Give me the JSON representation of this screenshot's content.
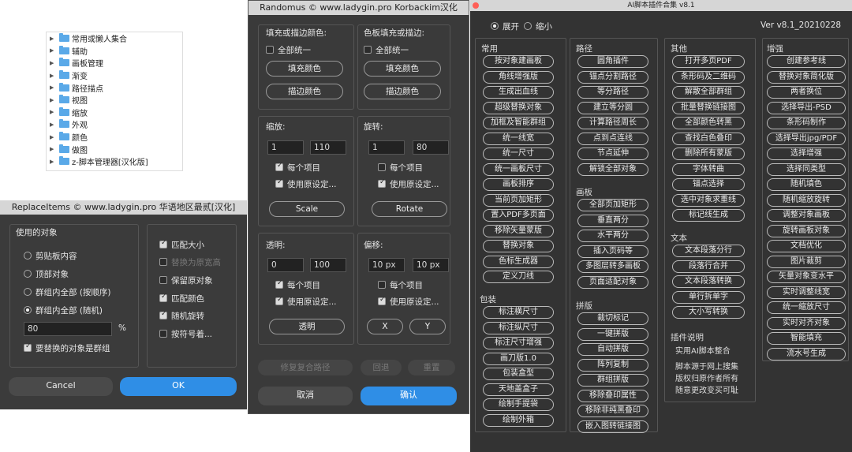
{
  "tree": {
    "items": [
      "常用或懒人集合",
      "辅助",
      "画板管理",
      "渐变",
      "路径描点",
      "视图",
      "缩放",
      "外观",
      "颜色",
      "做图",
      "z-脚本管理器[汉化版]"
    ]
  },
  "replace_items": {
    "title": "ReplaceItems © www.ladygin.pro 华语地区最贰[汉化]",
    "group_label": "使用的对象",
    "radios": [
      "剪贴板内容",
      "顶部对象",
      "群组内全部 (按顺序)",
      "群组内全部 (随机)"
    ],
    "percent_value": "80",
    "percent_sign": "%",
    "group_checkbox": "要替换的对象是群组",
    "checks": [
      "匹配大小",
      "替换为原宽高",
      "保留原对象",
      "匹配颜色",
      "随机旋转",
      "按符号着..."
    ],
    "cancel": "Cancel",
    "ok": "OK"
  },
  "randomus": {
    "title": "Randomus © www.ladygin.pro  Korbackim汉化",
    "fill_stroke": {
      "label": "填充或描边颜色:",
      "check": "全部统一",
      "fill": "填充颜色",
      "stroke": "描边颜色"
    },
    "swatch": {
      "label": "色板填充或描边:",
      "check": "全部统一",
      "fill": "填充颜色",
      "stroke": "描边颜色"
    },
    "scale": {
      "label": "缩放:",
      "min": "1",
      "max": "110",
      "each": "每个项目",
      "orig": "使用原设定...",
      "btn": "Scale"
    },
    "rotate": {
      "label": "旋转:",
      "min": "1",
      "max": "80",
      "each": "每个项目",
      "orig": "使用原设定...",
      "btn": "Rotate"
    },
    "opacity": {
      "label": "透明:",
      "min": "0",
      "max": "100",
      "each": "每个项目",
      "orig": "使用原设定...",
      "btn": "透明"
    },
    "offset": {
      "label": "偏移:",
      "min": "10 px",
      "max": "10 px",
      "each": "每个项目",
      "orig": "使用原设定...",
      "btnx": "X",
      "btny": "Y"
    },
    "restore": "修复复合路径",
    "back": "回退",
    "reset": "重置",
    "cancel": "取消",
    "confirm": "确认"
  },
  "ai": {
    "title": "AI脚本插件合集 v8.1",
    "expand": "展开",
    "shrink": "缩小",
    "version": "Ver v8.1_20210228",
    "common": {
      "head": "常用",
      "items": [
        "按对象建画板",
        "角线增强版",
        "生成出血线",
        "超级替换对象",
        "加框及智能群组",
        "统一线宽",
        "统一尺寸",
        "统一画板尺寸",
        "画板排序",
        "当前页加矩形",
        "置入PDF多页面",
        "移除矢量蒙版",
        "替换对象",
        "色标生成器",
        "定义刀线"
      ]
    },
    "package": {
      "head": "包装",
      "items": [
        "标注横尺寸",
        "标注纵尺寸",
        "标注尺寸增强",
        "画刀版1.0",
        "包装盒型",
        "天地盖盒子",
        "绘制手提袋",
        "绘制外箱"
      ]
    },
    "path": {
      "head": "路径",
      "items": [
        "圆角插件",
        "锚点分割路径",
        "等分路径",
        "建立等分圆",
        "计算路径周长",
        "点到点连线",
        "节点延伸",
        "解锁全部对象"
      ]
    },
    "artboard": {
      "head": "画板",
      "items": [
        "全部页加矩形",
        "垂直两分",
        "水平两分",
        "插入页码等",
        "多图层转多画板",
        "页面适配对象"
      ]
    },
    "imposition": {
      "head": "拼版",
      "items": [
        "裁切标记",
        "一键拼版",
        "自动拼版",
        "阵列复制",
        "群组拼版",
        "移除叠印属性",
        "移除非纯黑叠印",
        "嵌入图转链接图"
      ]
    },
    "other": {
      "head": "其他",
      "items": [
        "打开多页PDF",
        "条形码及二维码",
        "解散全部群组",
        "批量替换链接图",
        "全部颜色转黑",
        "查找白色叠印",
        "删除所有蒙版",
        "字体转曲",
        "锚点选择",
        "选中对象求重线",
        "标记线生成"
      ]
    },
    "text": {
      "head": "文本",
      "items": [
        "文本段落分行",
        "段落行合并",
        "文本段落转换",
        "单行拆单字",
        "大小写转换"
      ]
    },
    "plugin_info": {
      "head": "插件说明",
      "line1": "实用AI脚本整合",
      "line2": "脚本源于网上搜集",
      "line3": "版权归原作者所有",
      "line4": "随意更改变买可耻"
    },
    "enhance": {
      "head": "增强",
      "items": [
        "创建参考线",
        "替换对象简化版",
        "两者换位",
        "选择导出-PSD",
        "条形码制作",
        "选择导出jpg/PDF",
        "选择增强",
        "选择同类型",
        "随机填色",
        "随机缩放旋转",
        "调整对象画板",
        "旋转画板对象",
        "文档优化",
        "图片裁剪",
        "矢量对象变水平",
        "实时调整线宽",
        "统一缩放尺寸",
        "实时对齐对象",
        "智能填充",
        "流水号生成"
      ]
    }
  }
}
